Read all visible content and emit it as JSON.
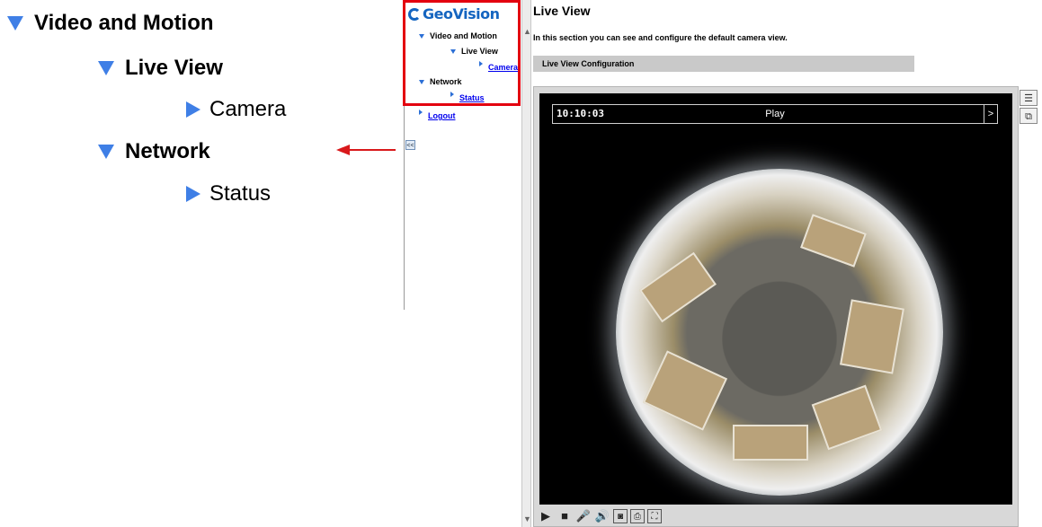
{
  "callout": {
    "items": [
      {
        "label": "Video and Motion",
        "level": 0,
        "expanded": true
      },
      {
        "label": "Live View",
        "level": 1,
        "expanded": true
      },
      {
        "label": "Camera",
        "level": 2
      },
      {
        "label": "Network",
        "level": 1,
        "expanded": true
      },
      {
        "label": "Status",
        "level": 2
      }
    ]
  },
  "sidebar": {
    "logo": "GeoVision",
    "items": [
      {
        "label": "Video and Motion"
      },
      {
        "label": "Live View"
      },
      {
        "label": "Camera",
        "link": true
      },
      {
        "label": "Network"
      },
      {
        "label": "Status",
        "link": true
      },
      {
        "label": "Logout",
        "link": true
      }
    ],
    "collapse_label": "<<"
  },
  "main": {
    "title": "Live View",
    "description": "In this section you can see and configure the default camera view.",
    "section_header": "Live View Configuration",
    "video": {
      "time": "10:10:03",
      "status": "Play",
      "next_label": ">"
    }
  },
  "controls": [
    "play-icon",
    "stop-icon",
    "microphone-icon",
    "speaker-icon",
    "snapshot-icon",
    "record-icon",
    "fullscreen-icon"
  ],
  "colors": {
    "accent_blue": "#3f7fe6",
    "highlight_red": "#e3000f",
    "logo_blue": "#1565c0"
  }
}
